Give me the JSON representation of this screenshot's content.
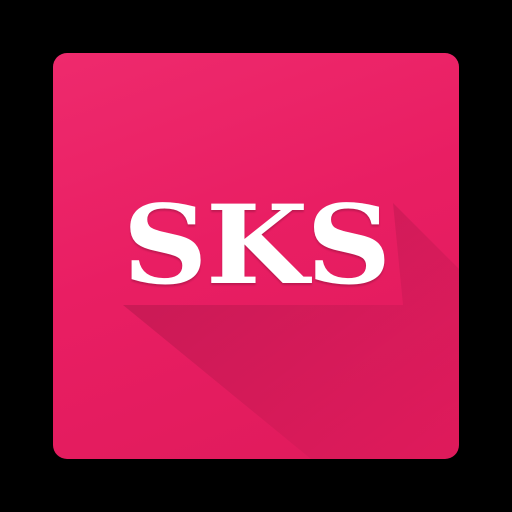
{
  "app_icon": {
    "text": "SKS",
    "icon_name": "sks-app-icon",
    "colors": {
      "background": "#e91e63",
      "text": "#ffffff",
      "outer": "#000000"
    }
  }
}
